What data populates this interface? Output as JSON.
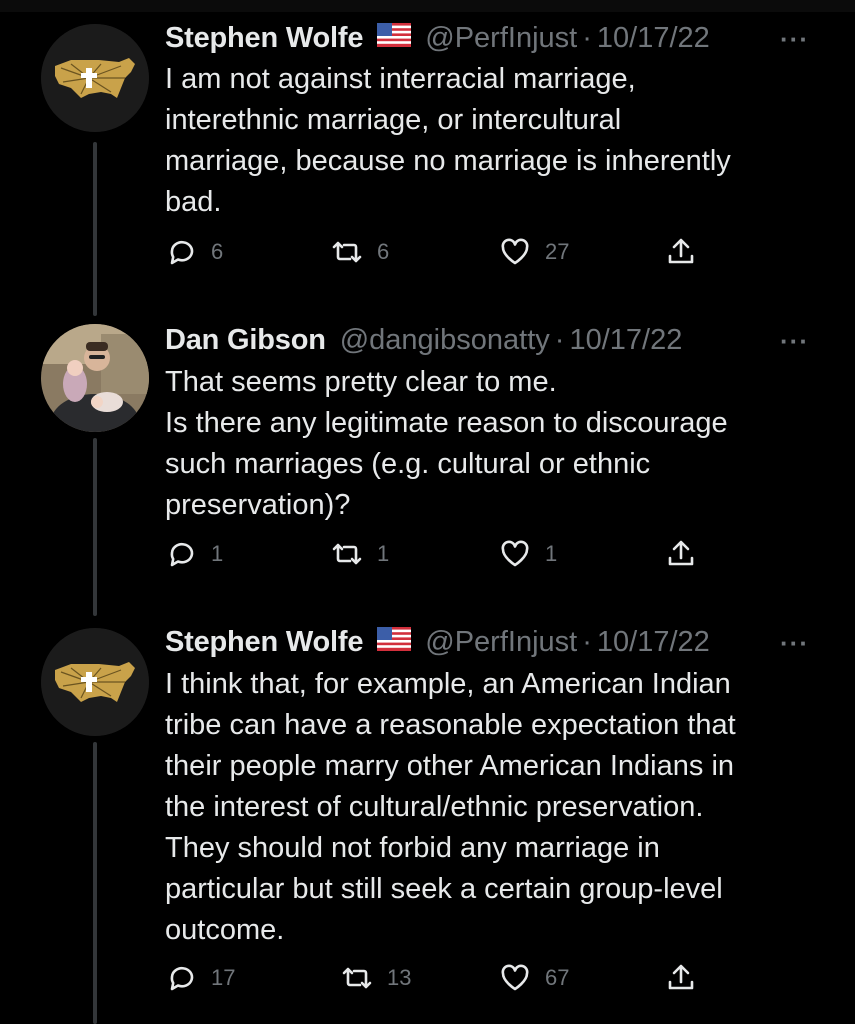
{
  "tweets": [
    {
      "author": "Stephen Wolfe",
      "flag_icon": "us-flag-icon",
      "handle": "@PerfInjust",
      "date": "10/17/22",
      "more": "···",
      "lines": [
        "I am not against interracial marriage,",
        "interethnic marriage, or intercultural",
        "marriage, because no marriage is inherently",
        "bad."
      ],
      "replies": "6",
      "retweets": "6",
      "likes": "27"
    },
    {
      "author": "Dan Gibson",
      "handle": "@dangibsonatty",
      "date": "10/17/22",
      "more": "···",
      "lines": [
        "That seems pretty clear to me.",
        "Is there any legitimate reason to discourage",
        "such marriages (e.g. cultural or ethnic",
        "preservation)?"
      ],
      "replies": "1",
      "retweets": "1",
      "likes": "1"
    },
    {
      "author": "Stephen Wolfe",
      "flag_icon": "us-flag-icon",
      "handle": "@PerfInjust",
      "date": "10/17/22",
      "more": "···",
      "lines": [
        "I think that, for example, an American Indian",
        "tribe can have a reasonable expectation that",
        "their people marry other American Indians in",
        "the interest of cultural/ethnic preservation.",
        "They should not forbid any marriage in",
        "particular but still seek a certain group-level",
        "outcome."
      ],
      "replies": "17",
      "retweets": "13",
      "likes": "67"
    }
  ],
  "colors": {
    "background": "#000000",
    "text": "#e7e9ea",
    "secondary": "#71767b",
    "thread_line": "#333639",
    "logo_gold": "#c9a24a"
  }
}
